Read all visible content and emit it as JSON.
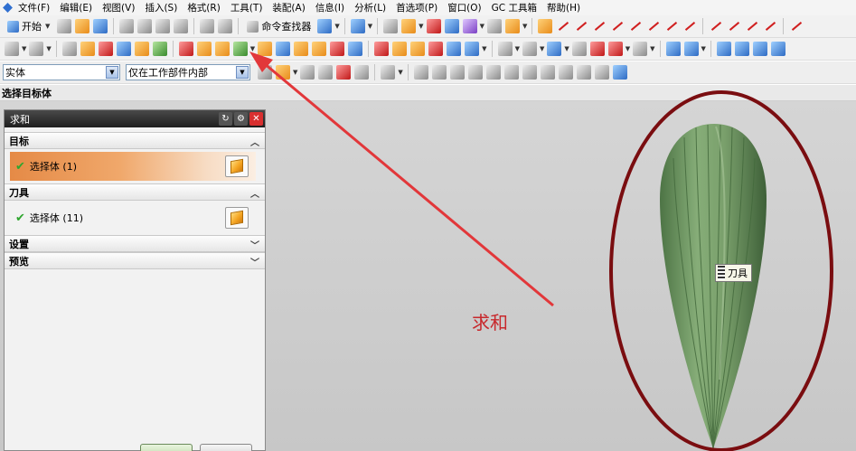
{
  "menubar": {
    "items": [
      "文件(F)",
      "编辑(E)",
      "视图(V)",
      "插入(S)",
      "格式(R)",
      "工具(T)",
      "装配(A)",
      "信息(I)",
      "分析(L)",
      "首选项(P)",
      "窗口(O)",
      "GC 工具箱",
      "帮助(H)"
    ]
  },
  "toolbar1": {
    "start_label": "开始",
    "command_finder_label": "命令查找器"
  },
  "selection_bar": {
    "type_filter_value": "实体",
    "scope_filter_value": "仅在工作部件内部"
  },
  "status_line": {
    "prompt": "选择目标体"
  },
  "dialog": {
    "title": "求和",
    "target_section": {
      "title": "目标",
      "selection_label": "选择体 (1)"
    },
    "tool_section": {
      "title": "刀具",
      "selection_label": "选择体 (11)"
    },
    "settings_section": {
      "title": "设置"
    },
    "preview_section": {
      "title": "预览"
    }
  },
  "viewport": {
    "tooltip_label": "刀具",
    "annotation_text": "求和",
    "body_color": "#6f9a62",
    "annotation_color": "#c8282c",
    "ellipse_color": "#7a0d10"
  }
}
